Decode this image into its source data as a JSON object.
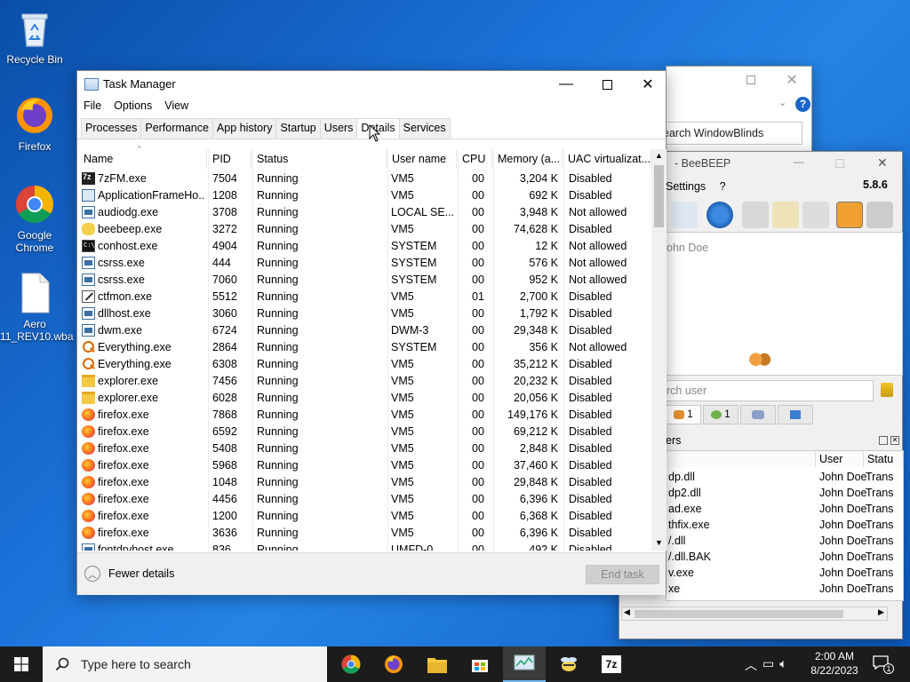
{
  "desktop": {
    "icons": [
      {
        "label": "Recycle Bin"
      },
      {
        "label": "Firefox"
      },
      {
        "label": "Google Chrome"
      },
      {
        "label": "Aero 11_REV10.wba"
      }
    ]
  },
  "task_manager": {
    "title": "Task Manager",
    "menu": [
      "File",
      "Options",
      "View"
    ],
    "tabs": [
      "Processes",
      "Performance",
      "App history",
      "Startup",
      "Users",
      "Details",
      "Services"
    ],
    "active_tab": "Details",
    "columns": [
      "Name",
      "PID",
      "Status",
      "User name",
      "CPU",
      "Memory (a...",
      "UAC virtualizat..."
    ],
    "rows": [
      {
        "icon": "7z-icon",
        "name": "7zFM.exe",
        "pid": "7504",
        "status": "Running",
        "user": "VM5",
        "cpu": "00",
        "mem": "3,204 K",
        "uac": "Disabled"
      },
      {
        "icon": "app-frame-icon",
        "name": "ApplicationFrameHo...",
        "pid": "1208",
        "status": "Running",
        "user": "VM5",
        "cpu": "00",
        "mem": "692 K",
        "uac": "Disabled"
      },
      {
        "icon": "generic-process-icon",
        "name": "audiodg.exe",
        "pid": "3708",
        "status": "Running",
        "user": "LOCAL SE...",
        "cpu": "00",
        "mem": "3,948 K",
        "uac": "Not allowed"
      },
      {
        "icon": "beebeep-icon",
        "name": "beebeep.exe",
        "pid": "3272",
        "status": "Running",
        "user": "VM5",
        "cpu": "00",
        "mem": "74,628 K",
        "uac": "Disabled"
      },
      {
        "icon": "console-icon",
        "name": "conhost.exe",
        "pid": "4904",
        "status": "Running",
        "user": "SYSTEM",
        "cpu": "00",
        "mem": "12 K",
        "uac": "Not allowed"
      },
      {
        "icon": "generic-process-icon",
        "name": "csrss.exe",
        "pid": "444",
        "status": "Running",
        "user": "SYSTEM",
        "cpu": "00",
        "mem": "576 K",
        "uac": "Not allowed"
      },
      {
        "icon": "generic-process-icon",
        "name": "csrss.exe",
        "pid": "7060",
        "status": "Running",
        "user": "SYSTEM",
        "cpu": "00",
        "mem": "952 K",
        "uac": "Not allowed"
      },
      {
        "icon": "ctfmon-icon",
        "name": "ctfmon.exe",
        "pid": "5512",
        "status": "Running",
        "user": "VM5",
        "cpu": "01",
        "mem": "2,700 K",
        "uac": "Disabled"
      },
      {
        "icon": "generic-process-icon",
        "name": "dllhost.exe",
        "pid": "3060",
        "status": "Running",
        "user": "VM5",
        "cpu": "00",
        "mem": "1,792 K",
        "uac": "Disabled"
      },
      {
        "icon": "generic-process-icon",
        "name": "dwm.exe",
        "pid": "6724",
        "status": "Running",
        "user": "DWM-3",
        "cpu": "00",
        "mem": "29,348 K",
        "uac": "Disabled"
      },
      {
        "icon": "everything-search-icon",
        "name": "Everything.exe",
        "pid": "2864",
        "status": "Running",
        "user": "SYSTEM",
        "cpu": "00",
        "mem": "356 K",
        "uac": "Not allowed"
      },
      {
        "icon": "everything-search-icon",
        "name": "Everything.exe",
        "pid": "6308",
        "status": "Running",
        "user": "VM5",
        "cpu": "00",
        "mem": "35,212 K",
        "uac": "Disabled"
      },
      {
        "icon": "explorer-folder-icon",
        "name": "explorer.exe",
        "pid": "7456",
        "status": "Running",
        "user": "VM5",
        "cpu": "00",
        "mem": "20,232 K",
        "uac": "Disabled"
      },
      {
        "icon": "explorer-folder-icon",
        "name": "explorer.exe",
        "pid": "6028",
        "status": "Running",
        "user": "VM5",
        "cpu": "00",
        "mem": "20,056 K",
        "uac": "Disabled"
      },
      {
        "icon": "firefox-icon",
        "name": "firefox.exe",
        "pid": "7868",
        "status": "Running",
        "user": "VM5",
        "cpu": "00",
        "mem": "149,176 K",
        "uac": "Disabled"
      },
      {
        "icon": "firefox-icon",
        "name": "firefox.exe",
        "pid": "6592",
        "status": "Running",
        "user": "VM5",
        "cpu": "00",
        "mem": "69,212 K",
        "uac": "Disabled"
      },
      {
        "icon": "firefox-icon",
        "name": "firefox.exe",
        "pid": "5408",
        "status": "Running",
        "user": "VM5",
        "cpu": "00",
        "mem": "2,848 K",
        "uac": "Disabled"
      },
      {
        "icon": "firefox-icon",
        "name": "firefox.exe",
        "pid": "5968",
        "status": "Running",
        "user": "VM5",
        "cpu": "00",
        "mem": "37,460 K",
        "uac": "Disabled"
      },
      {
        "icon": "firefox-icon",
        "name": "firefox.exe",
        "pid": "1048",
        "status": "Running",
        "user": "VM5",
        "cpu": "00",
        "mem": "29,848 K",
        "uac": "Disabled"
      },
      {
        "icon": "firefox-icon",
        "name": "firefox.exe",
        "pid": "4456",
        "status": "Running",
        "user": "VM5",
        "cpu": "00",
        "mem": "6,396 K",
        "uac": "Disabled"
      },
      {
        "icon": "firefox-icon",
        "name": "firefox.exe",
        "pid": "1200",
        "status": "Running",
        "user": "VM5",
        "cpu": "00",
        "mem": "6,368 K",
        "uac": "Disabled"
      },
      {
        "icon": "firefox-icon",
        "name": "firefox.exe",
        "pid": "3636",
        "status": "Running",
        "user": "VM5",
        "cpu": "00",
        "mem": "6,396 K",
        "uac": "Disabled"
      },
      {
        "icon": "generic-process-icon",
        "name": "fontdrvhost.exe",
        "pid": "836",
        "status": "Running",
        "user": "UMFD-0",
        "cpu": "00",
        "mem": "492 K",
        "uac": "Disabled"
      }
    ],
    "footer": {
      "fewer_details": "Fewer details",
      "end_task": "End task"
    }
  },
  "windowblinds": {
    "search_text": "earch WindowBlinds",
    "help_glyph": "?"
  },
  "beebeep": {
    "title": "- BeeBEEP",
    "menu": [
      "Settings",
      "?"
    ],
    "version": "5.8.6",
    "user_name": "ohn Doe",
    "search_placeholder": "rch user",
    "user_tabs": [
      {
        "count": "1"
      },
      {
        "count": "1"
      },
      {
        "count": ""
      },
      {
        "count": ""
      }
    ],
    "transfers_label": "ers",
    "transfer_columns": [
      "User",
      "Statu"
    ],
    "transfers": [
      {
        "file": "dp.dll",
        "user": "John Doe",
        "status": "Trans"
      },
      {
        "file": "dp2.dll",
        "user": "John Doe",
        "status": "Trans"
      },
      {
        "file": "ad.exe",
        "user": "John Doe",
        "status": "Trans"
      },
      {
        "file": "thfix.exe",
        "user": "John Doe",
        "status": "Trans"
      },
      {
        "file": "/.dll",
        "user": "John Doe",
        "status": "Trans"
      },
      {
        "file": "/.dll.BAK",
        "user": "John Doe",
        "status": "Trans"
      },
      {
        "file": "v.exe",
        "user": "John Doe",
        "status": "Trans"
      },
      {
        "file": "xe",
        "user": "John Doe",
        "status": "Trans"
      }
    ]
  },
  "taskbar": {
    "search_placeholder": "Type here to search",
    "apps": [
      "chrome-icon",
      "firefox-icon",
      "file-explorer-icon",
      "store-icon",
      "task-manager-icon",
      "beebeep-icon",
      "7zip-icon"
    ],
    "time": "2:00 AM",
    "date": "8/22/2023",
    "notification_count": "1"
  }
}
